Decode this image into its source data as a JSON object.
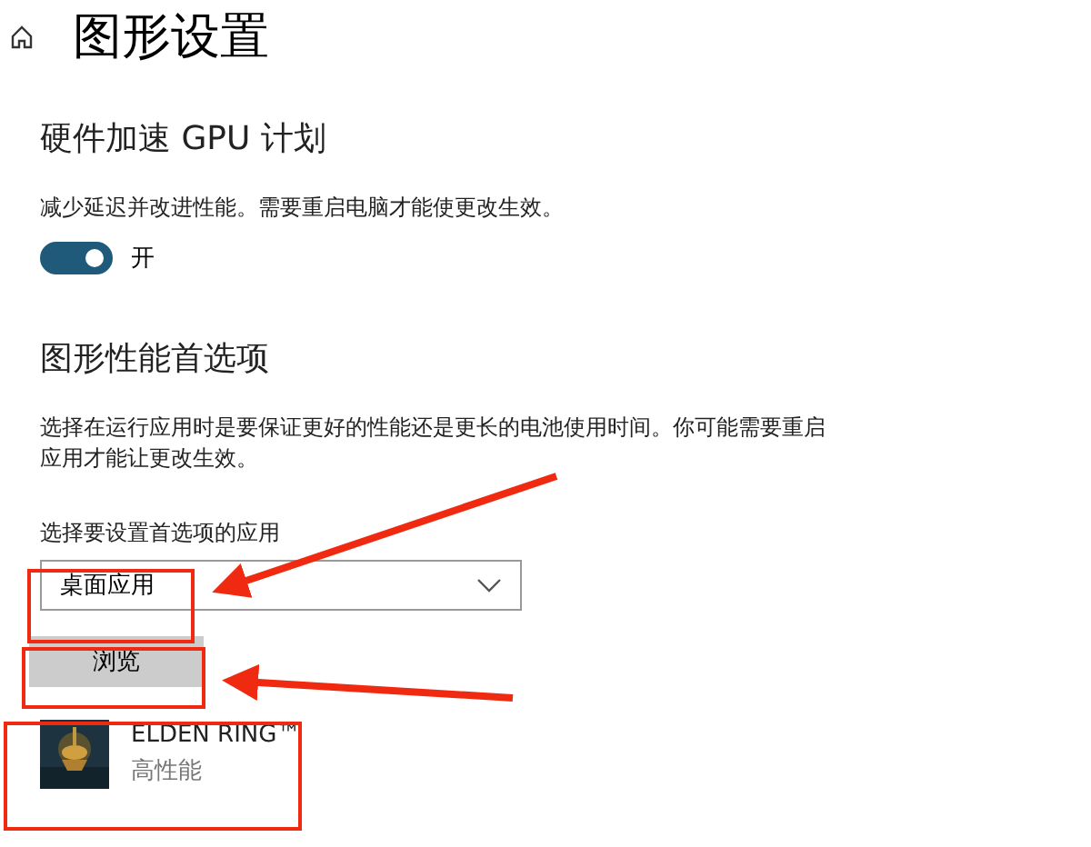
{
  "page": {
    "title": "图形设置"
  },
  "gpu_scheduling": {
    "heading": "硬件加速 GPU 计划",
    "description": "减少延迟并改进性能。需要重启电脑才能使更改生效。",
    "toggle": {
      "on": true,
      "label": "开"
    }
  },
  "preference": {
    "heading": "图形性能首选项",
    "description": "选择在运行应用时是要保证更好的性能还是更长的电池使用时间。你可能需要重启应用才能让更改生效。",
    "dropdown_label": "选择要设置首选项的应用",
    "dropdown_value": "桌面应用",
    "browse_button": "浏览"
  },
  "apps": [
    {
      "name": "ELDEN RING™",
      "setting": "高性能"
    }
  ]
}
